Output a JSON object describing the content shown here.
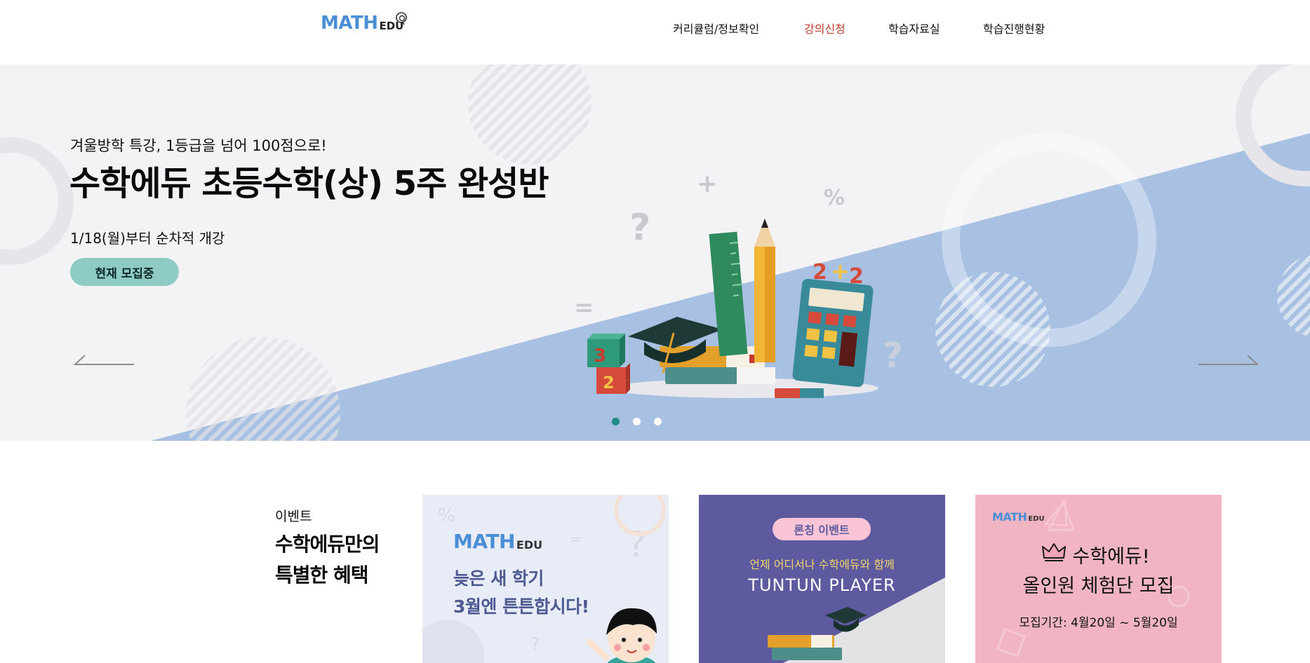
{
  "header": {
    "logo_main": "MATH",
    "logo_sub": "EDU",
    "nav": [
      {
        "label": "커리큘럼/정보확인"
      },
      {
        "label": "강의신청"
      },
      {
        "label": "학습자료실"
      },
      {
        "label": "학습진행현황"
      }
    ],
    "active_nav": "강의신청"
  },
  "hero": {
    "subtitle": "겨울방학 특강, 1등급을 넘어 100점으로!",
    "title": "수학에듀 초등수학(상) 5주 완성반",
    "date": "1/18(월)부터 순차적 개강",
    "button": "현재 모집중",
    "slides_total": 3,
    "active_slide": 1,
    "illustration_text": [
      "2",
      "+",
      "2",
      "3",
      "2",
      "?",
      "?",
      "%",
      "+",
      "="
    ]
  },
  "events": {
    "label": "이벤트",
    "title_line1": "수학에듀만의",
    "title_line2": "특별한 혜택",
    "cards": [
      {
        "logo_main": "MATH",
        "logo_sub": "EDU",
        "line1": "늦은 새 학기",
        "line2": "3월엔 튼튼합시다!",
        "decor": [
          "%",
          "?",
          "=",
          "?",
          "="
        ]
      },
      {
        "pill": "론칭 이벤트",
        "sub": "언제 어디서나 수학에듀와 함께",
        "player": "TUNTUN PLAYER"
      },
      {
        "logo_main": "MATH",
        "logo_sub": "EDU",
        "line1": "수학에듀!",
        "line2": "올인원 체험단 모집",
        "period": "모집기간: 4월20일 ~ 5월20일"
      }
    ]
  },
  "colors": {
    "accent_blue": "#4a8fd6",
    "nav_active": "#c0392b",
    "hero_bg": "#f3f3f5",
    "hero_blue": "#a8c0e2",
    "button_teal": "#8ecbc4",
    "dot_active": "#1e8c86",
    "card1_bg": "#e8ecf7",
    "card2_bg": "#5d5aa0",
    "card3_bg": "#f0b4c2"
  },
  "icons": [
    "logo-mark-icon",
    "arrow-left-icon",
    "arrow-right-icon",
    "crown-icon",
    "graduation-cap-icon",
    "calculator-icon",
    "pencil-icon",
    "ruler-icon",
    "books-icon",
    "boy-character-icon"
  ]
}
